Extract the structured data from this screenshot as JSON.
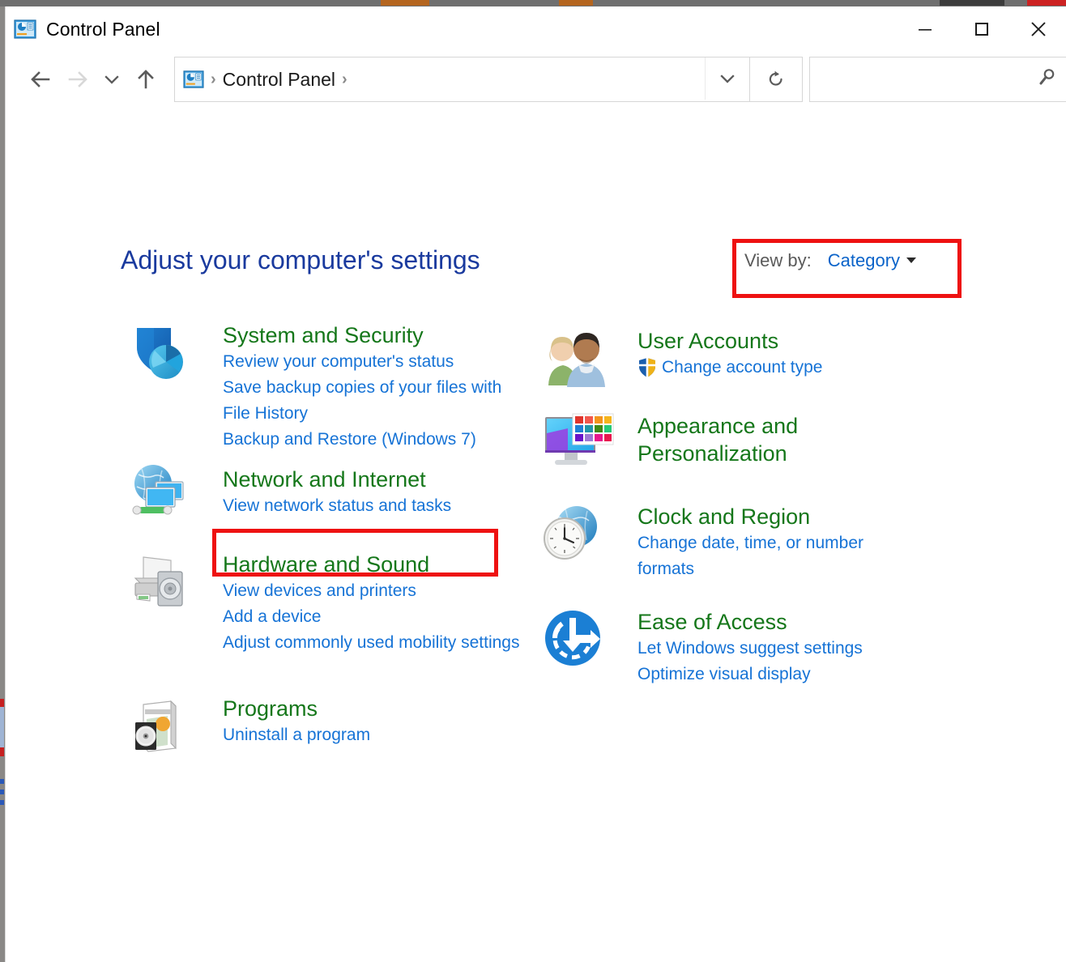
{
  "window": {
    "title": "Control Panel",
    "title_icon": "control-panel-icon",
    "caption": {
      "minimize": "minimize-icon",
      "maximize": "maximize-icon",
      "close": "close-icon"
    }
  },
  "toolbar": {
    "back": "back-arrow-icon",
    "forward": "forward-arrow-icon",
    "recent": "chevron-down-icon",
    "up": "up-arrow-icon",
    "address": {
      "icon": "control-panel-icon",
      "crumbs": [
        "Control Panel"
      ],
      "separator": "›",
      "dropdown": "chevron-down-icon"
    },
    "refresh": "refresh-icon",
    "search": {
      "value": "",
      "placeholder": "",
      "icon": "search-icon"
    }
  },
  "page": {
    "heading": "Adjust your computer's settings",
    "view_by": {
      "label": "View by:",
      "value": "Category",
      "caret": "caret-down-icon"
    }
  },
  "highlights": [
    {
      "name": "view-by-highlight",
      "color": "#ee1111"
    },
    {
      "name": "network-status-highlight",
      "color": "#ee1111"
    }
  ],
  "colors": {
    "heading": "#1a3a9e",
    "category_title": "#15771a",
    "link": "#1673d6",
    "label": "#5a5a5a",
    "highlight": "#ee1111"
  },
  "categories": {
    "left": [
      {
        "icon": "shield-pie-icon",
        "title": "System and Security",
        "links": [
          "Review your computer's status",
          "Save backup copies of your files with File History",
          "Backup and Restore (Windows 7)"
        ]
      },
      {
        "icon": "globe-monitors-icon",
        "title": "Network and Internet",
        "links": [
          "View network status and tasks"
        ]
      },
      {
        "icon": "printer-speaker-icon",
        "title": "Hardware and Sound",
        "links": [
          "View devices and printers",
          "Add a device",
          "Adjust commonly used mobility settings"
        ]
      },
      {
        "icon": "software-box-cd-icon",
        "title": "Programs",
        "links": [
          "Uninstall a program"
        ]
      }
    ],
    "right": [
      {
        "icon": "user-accounts-icon",
        "title": "User Accounts",
        "links": [
          "Change account type"
        ],
        "link_icon": "uac-shield-icon"
      },
      {
        "icon": "monitor-palette-icon",
        "title": "Appearance and Personalization",
        "links": []
      },
      {
        "icon": "clock-globe-icon",
        "title": "Clock and Region",
        "links": [
          "Change date, time, or number formats"
        ]
      },
      {
        "icon": "ease-of-access-icon",
        "title": "Ease of Access",
        "links": [
          "Let Windows suggest settings",
          "Optimize visual display"
        ]
      }
    ]
  }
}
